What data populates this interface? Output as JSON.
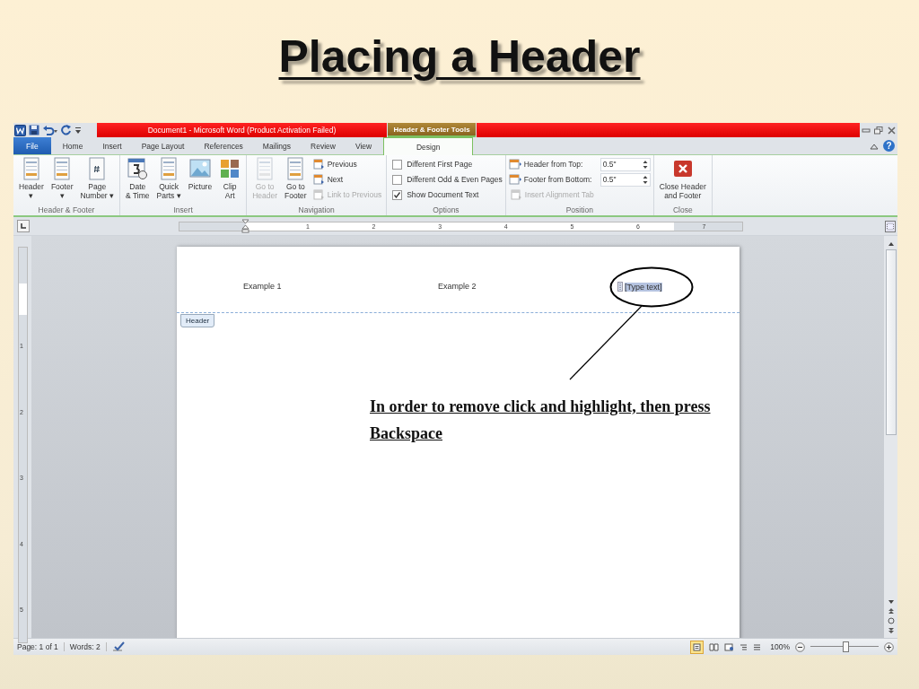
{
  "slide_title": "Placing a Header",
  "window": {
    "title": "Document1  -  Microsoft Word (Product Activation Failed)",
    "contextual_group": "Header & Footer Tools",
    "help_glyph": "?"
  },
  "tabs": [
    {
      "label": "File",
      "kind": "file",
      "selected": false
    },
    {
      "label": "Home",
      "kind": "normal",
      "selected": false
    },
    {
      "label": "Insert",
      "kind": "normal",
      "selected": false
    },
    {
      "label": "Page Layout",
      "kind": "normal",
      "selected": false
    },
    {
      "label": "References",
      "kind": "normal",
      "selected": false
    },
    {
      "label": "Mailings",
      "kind": "normal",
      "selected": false
    },
    {
      "label": "Review",
      "kind": "normal",
      "selected": false
    },
    {
      "label": "View",
      "kind": "normal",
      "selected": false
    },
    {
      "label": "Design",
      "kind": "contextual",
      "selected": true
    }
  ],
  "ribbon_groups": [
    {
      "title": "Header & Footer",
      "items": [
        {
          "kind": "large",
          "lines": [
            "Header",
            "▾"
          ],
          "disabled": false
        },
        {
          "kind": "large",
          "lines": [
            "Footer",
            "▾"
          ],
          "disabled": false
        },
        {
          "kind": "large",
          "lines": [
            "Page",
            "Number ▾"
          ],
          "disabled": false
        }
      ]
    },
    {
      "title": "Insert",
      "items": [
        {
          "kind": "large",
          "lines": [
            "Date",
            "& Time"
          ],
          "disabled": false
        },
        {
          "kind": "large",
          "lines": [
            "Quick",
            "Parts ▾"
          ],
          "disabled": false
        },
        {
          "kind": "large",
          "lines": [
            "Picture"
          ],
          "disabled": false
        },
        {
          "kind": "large",
          "lines": [
            "Clip",
            "Art"
          ],
          "disabled": false
        }
      ]
    },
    {
      "title": "Navigation",
      "items": [
        {
          "kind": "large",
          "lines": [
            "Go to",
            "Header"
          ],
          "disabled": true
        },
        {
          "kind": "large",
          "lines": [
            "Go to",
            "Footer"
          ],
          "disabled": false
        },
        {
          "kind": "small",
          "label": "Previous",
          "disabled": false
        },
        {
          "kind": "small",
          "label": "Next",
          "disabled": false
        },
        {
          "kind": "small",
          "label": "Link to Previous",
          "disabled": true
        }
      ]
    },
    {
      "title": "Options",
      "items": [
        {
          "kind": "check",
          "label": "Different First Page",
          "checked": false
        },
        {
          "kind": "check",
          "label": "Different Odd & Even Pages",
          "checked": false
        },
        {
          "kind": "check",
          "label": "Show Document Text",
          "checked": true
        }
      ]
    },
    {
      "title": "Position",
      "items": [
        {
          "kind": "spin",
          "label": "Header from Top:",
          "value": "0.5\""
        },
        {
          "kind": "spin",
          "label": "Footer from Bottom:",
          "value": "0.5\""
        },
        {
          "kind": "small",
          "label": "Insert Alignment Tab",
          "disabled": true
        }
      ]
    },
    {
      "title": "Close",
      "items": [
        {
          "kind": "large",
          "lines": [
            "Close Header",
            "and Footer"
          ],
          "disabled": false
        }
      ]
    }
  ],
  "ruler": {
    "numbers": [
      "1",
      "2",
      "3",
      "4",
      "5",
      "6",
      "7"
    ]
  },
  "vertical_ruler": {
    "numbers": [
      "1",
      "2",
      "3",
      "4",
      "5"
    ]
  },
  "document": {
    "header_texts": [
      {
        "text": "Example 1",
        "selected": false
      },
      {
        "text": "Example 2",
        "selected": false
      },
      {
        "text": "[Type text]",
        "selected": true
      }
    ],
    "header_tag": "Header"
  },
  "annotation": "In order to remove click and highlight, then press Backspace",
  "status_bar": {
    "page": "Page: 1 of 1",
    "words": "Words: 2",
    "zoom": "100%",
    "zoom_slider": {
      "level": 0.5
    }
  }
}
